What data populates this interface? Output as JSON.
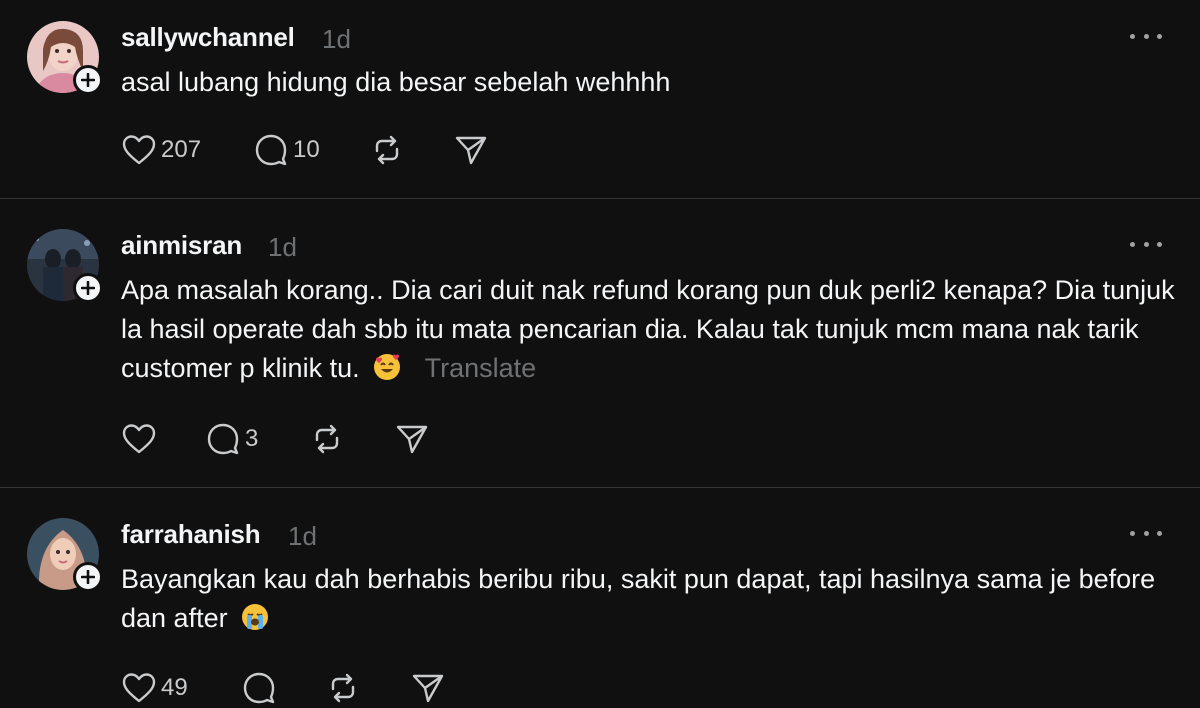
{
  "posts": [
    {
      "username": "sallywchannel",
      "time": "1d",
      "text": "asal lubang hidung dia besar sebelah wehhhh",
      "likes": "207",
      "replies": "10",
      "avatar_icon": "avatar-woman-pink-icon"
    },
    {
      "username": "ainmisran",
      "time": "1d",
      "text": "Apa masalah korang.. Dia cari duit nak refund korang pun duk perli2 kenapa? Dia tunjuk la hasil operate dah sbb itu mata pencarian dia. Kalau tak tunjuk mcm mana nak tarik customer p klinik tu.",
      "translate": "Translate",
      "emoji": "smiling-face-with-hearts",
      "likes": "",
      "replies": "3",
      "avatar_icon": "avatar-couple-icon"
    },
    {
      "username": "farrahanish",
      "time": "1d",
      "text": "Bayangkan kau dah berhabis beribu ribu, sakit pun dapat, tapi hasilnya sama je before dan after",
      "emoji": "loudly-crying-face",
      "likes": "49",
      "replies": "",
      "avatar_icon": "avatar-woman-hijab-icon"
    }
  ],
  "colors": {
    "background": "#101010",
    "text": "#f3f5f7",
    "muted": "#6f7274",
    "divider": "#333638"
  }
}
